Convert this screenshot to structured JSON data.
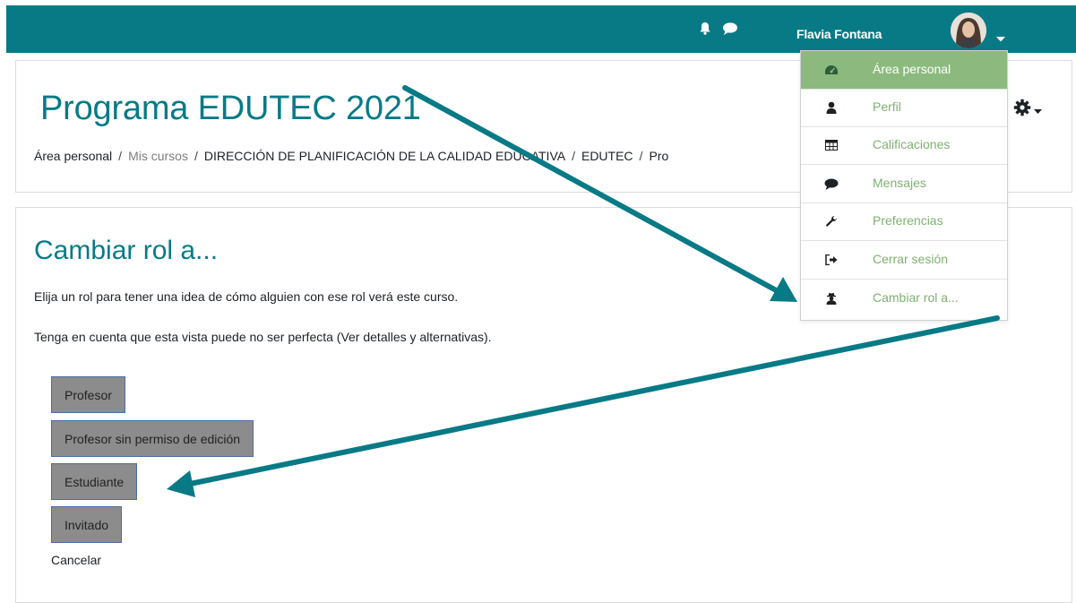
{
  "navbar": {
    "user_name": "Flavia Fontana",
    "bg_color": "#087a86",
    "icons": [
      "bell-icon",
      "chat-icon",
      "caret-down-icon"
    ]
  },
  "user_menu": {
    "items": [
      {
        "label": "Área personal",
        "icon": "dashboard-icon",
        "active": true
      },
      {
        "label": "Perfil",
        "icon": "user-icon",
        "active": false
      },
      {
        "label": "Calificaciones",
        "icon": "table-icon",
        "active": false
      },
      {
        "label": "Mensajes",
        "icon": "chat-icon",
        "active": false
      },
      {
        "label": "Preferencias",
        "icon": "wrench-icon",
        "active": false
      },
      {
        "label": "Cerrar sesión",
        "icon": "sign-out-icon",
        "active": false
      },
      {
        "label": "Cambiar rol a...",
        "icon": "user-secret-icon",
        "active": false
      }
    ],
    "active_color": "#8cba7e",
    "link_color": "#7fb071"
  },
  "header": {
    "course_title": "Programa EDUTEC 2021",
    "breadcrumb": [
      {
        "label": "Área personal",
        "muted": false
      },
      {
        "label": "Mis cursos",
        "muted": true
      },
      {
        "label": "DIRECCIÓN DE PLANIFICACIÓN DE LA CALIDAD EDUCATIVA",
        "muted": false
      },
      {
        "label": "EDUTEC",
        "muted": false
      },
      {
        "label": "Pro",
        "muted": false
      }
    ],
    "settings_icon": "gear-icon"
  },
  "main": {
    "heading": "Cambiar rol a...",
    "intro": "Elija un rol para tener una idea de cómo alguien con ese rol verá este curso.",
    "note_prefix": "Tenga en cuenta que esta vista puede no ser perfecta (",
    "note_link": "Ver detalles y alternativas",
    "note_suffix": ").",
    "roles": [
      "Profesor",
      "Profesor sin permiso de edición",
      "Estudiante",
      "Invitado"
    ],
    "cancel": "Cancelar"
  },
  "annotation": {
    "arrow_color": "#087a86"
  }
}
